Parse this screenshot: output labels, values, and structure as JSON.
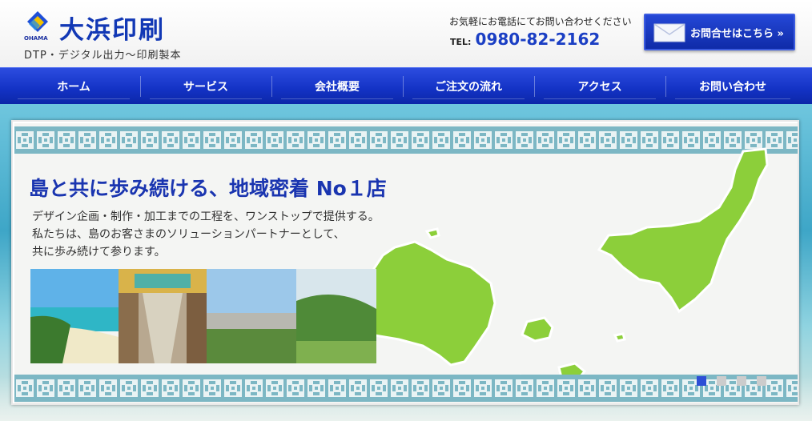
{
  "header": {
    "logo_sub": "OHAMA",
    "logo_title": "大浜印刷",
    "tagline": "DTP・デジタル出力〜印刷製本",
    "contact_note": "お気軽にお電話にてお問い合わせください",
    "tel_prefix": "TEL:",
    "tel_number": "0980-82-2162",
    "inquiry_label": "お問合せはこちら »"
  },
  "nav": {
    "items": [
      {
        "label": "ホーム"
      },
      {
        "label": "サービス"
      },
      {
        "label": "会社概要"
      },
      {
        "label": "ご注文の流れ"
      },
      {
        "label": "アクセス"
      },
      {
        "label": "お問い合わせ"
      }
    ]
  },
  "hero": {
    "headline": "島と共に歩み続ける、地域密着 No１店",
    "lines": [
      "デザイン企画・制作・加工までの工程を、ワンストップで提供する。",
      "私たちは、島のお客さまのソリューションパートナーとして、",
      "共に歩み続けて参ります。"
    ],
    "slide_count": 4,
    "active_slide": 1
  },
  "colors": {
    "brand_blue": "#1238b5",
    "nav_blue": "#1332c4",
    "island_green": "#8ccf3a",
    "pattern_teal": "#7cb7c4"
  }
}
